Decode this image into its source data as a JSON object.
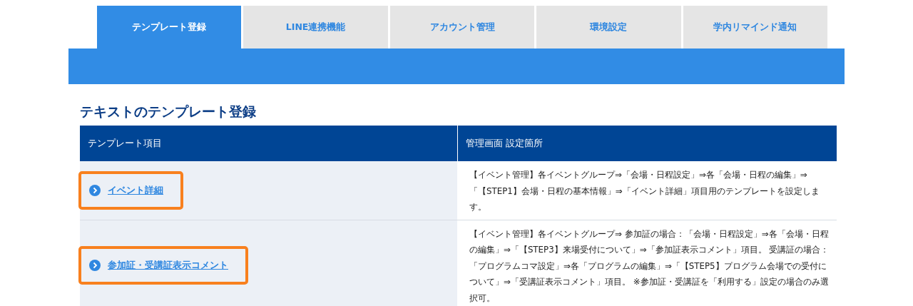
{
  "tabs": [
    {
      "label": "テンプレート登録",
      "selected": true
    },
    {
      "label": "LINE連携機能",
      "selected": false
    },
    {
      "label": "アカウント管理",
      "selected": false
    },
    {
      "label": "環境設定",
      "selected": false
    },
    {
      "label": "学内リマインド通知",
      "selected": false
    }
  ],
  "heading": "テキストのテンプレート登録",
  "table": {
    "columns": [
      "テンプレート項目",
      "管理画面 設定箇所"
    ],
    "rows": [
      {
        "item": "イベント詳細",
        "highlighted": true,
        "location": "【イベント管理】各イベントグループ⇒「会場・日程設定」⇒各「会場・日程の編集」⇒「【STEP1】会場・日程の基本情報」⇒「イベント詳細」項目用のテンプレートを設定します。"
      },
      {
        "item": "参加証・受講証表示コメント",
        "highlighted": true,
        "location": "【イベント管理】各イベントグループ⇒ 参加証の場合：「会場・日程設定」⇒各「会場・日程の編集」⇒「【STEP3】来場受付について」⇒「参加証表示コメント」項目。 受講証の場合：「プログラムコマ設定」⇒各「プログラムの編集」⇒「【STEP5】プログラム会場での受付について」⇒「受講証表示コメント」項目。 ※参加証・受講証を「利用する」設定の場合のみ選択可。"
      }
    ]
  }
}
